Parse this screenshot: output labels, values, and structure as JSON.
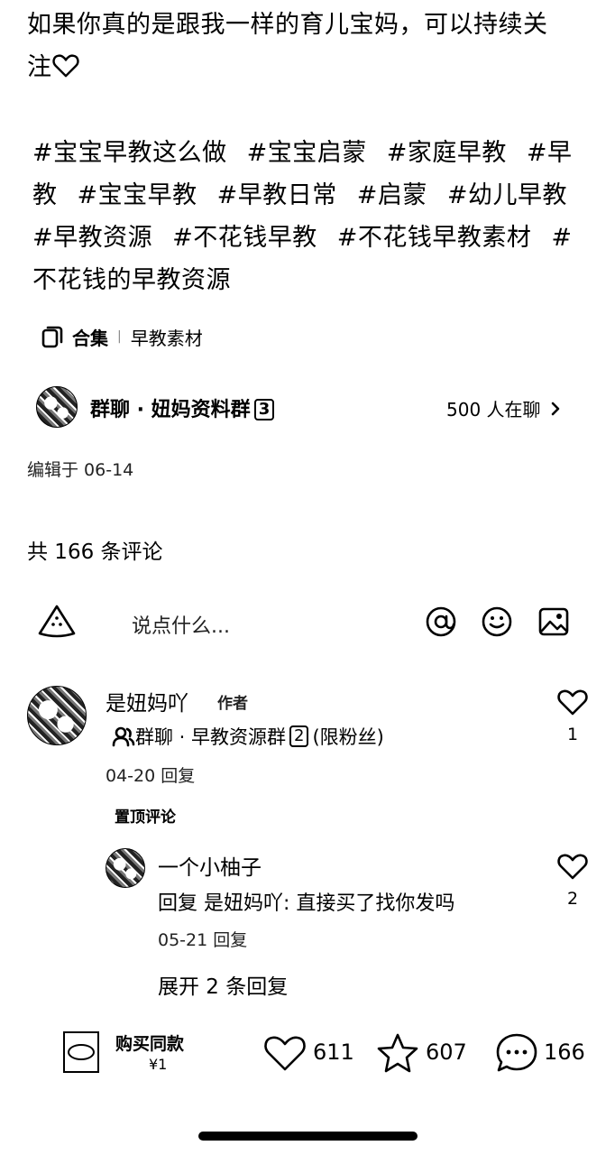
{
  "post": {
    "body_line1": "如果你真的是跟我一样的育儿宝妈，可以持续关",
    "body_line2": "注",
    "tags": [
      "#宝宝早教这么做",
      "#宝宝启蒙",
      "#家庭早教",
      "#早教",
      "#宝宝早教",
      "#早教日常",
      "#启蒙",
      "#幼儿早教",
      "#早教资源",
      "#不花钱早教",
      "#不花钱早教素材",
      "#不花钱的早教资源"
    ],
    "tag_lines": [
      [
        "#宝宝早教这么做",
        "#宝宝启蒙",
        "#家庭早教",
        "#早"
      ],
      [
        "教",
        "#宝宝早教",
        "#早教日常",
        "#启蒙",
        "#幼儿早教"
      ],
      [
        "#早教资源",
        "#不花钱早教",
        "#不花钱早教素材",
        "#"
      ],
      [
        "不花钱的早教资源"
      ]
    ],
    "collection_label": "合集",
    "collection_name": "早教素材",
    "group_name": "群聊 · 妞妈资料群",
    "group_badge": "3",
    "group_count": "500 人在聊",
    "edited": "编辑于 06-14"
  },
  "comments_header": {
    "total": "共 166 条评论",
    "input_placeholder": "说点什么..."
  },
  "comments": [
    {
      "username": "是妞妈吖",
      "author_tag": "作者",
      "group_text": "群聊 · 早教资源群",
      "group_badge": "2",
      "group_suffix": "(限粉丝)",
      "date": "04-20",
      "reply_label": "回复",
      "likes": "1",
      "pinned": "置顶评论"
    }
  ],
  "replies": [
    {
      "username": "一个小柚子",
      "text": "回复 是妞妈吖: 直接买了找你发吗",
      "date": "05-21",
      "reply_label": "回复",
      "likes": "2"
    }
  ],
  "expand_replies": "展开 2 条回复",
  "bottom_bar": {
    "buy_label": "购买同款",
    "price": "¥1",
    "likes": "611",
    "stars": "607",
    "comments": "166"
  }
}
